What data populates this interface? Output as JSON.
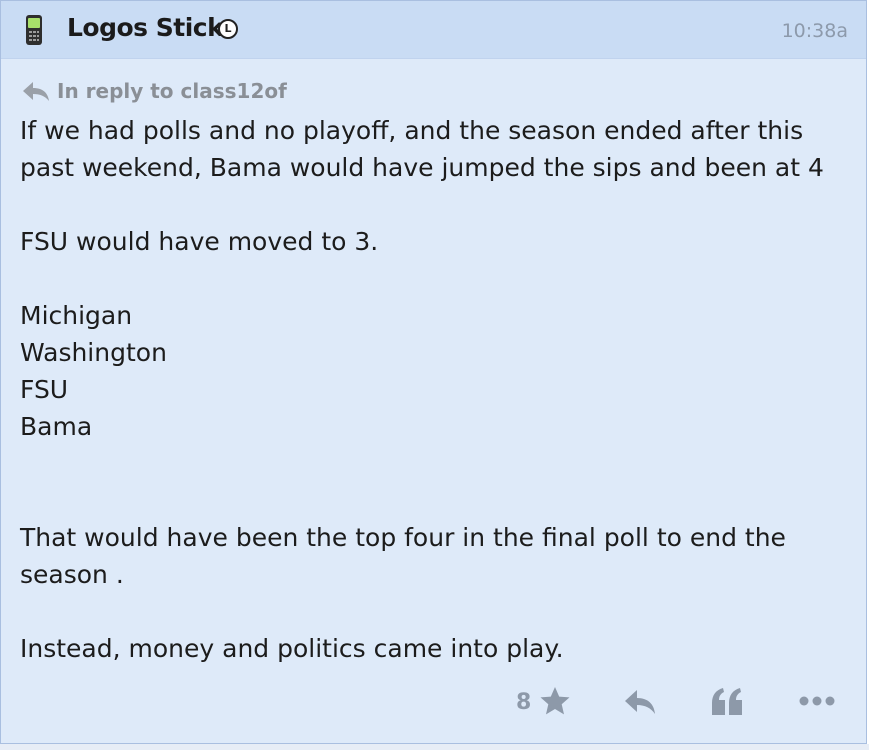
{
  "post": {
    "author": "Logos Stick",
    "badge": "L",
    "time": "10:38a",
    "reply_to": "In reply to class12of",
    "body": [
      "If we had polls and no playoff, and the season ended after this",
      "past weekend, Bama would have jumped the sips and been at 4",
      "",
      "FSU would have moved to 3.",
      "",
      "Michigan",
      "Washington",
      "FSU",
      "Bama",
      "",
      "",
      "That would have been the top four in the final poll to end the",
      "season .",
      "",
      "Instead, money and politics came into play."
    ]
  },
  "actions": {
    "star_count": "8",
    "icons": [
      "star-icon",
      "reply-icon",
      "quote-icon",
      "more-icon"
    ]
  },
  "colors": {
    "header_bg": "#c9dcf4",
    "body_bg": "#deeaf9",
    "icon_gray": "#8d99a9",
    "text": "#1c1c1c"
  }
}
